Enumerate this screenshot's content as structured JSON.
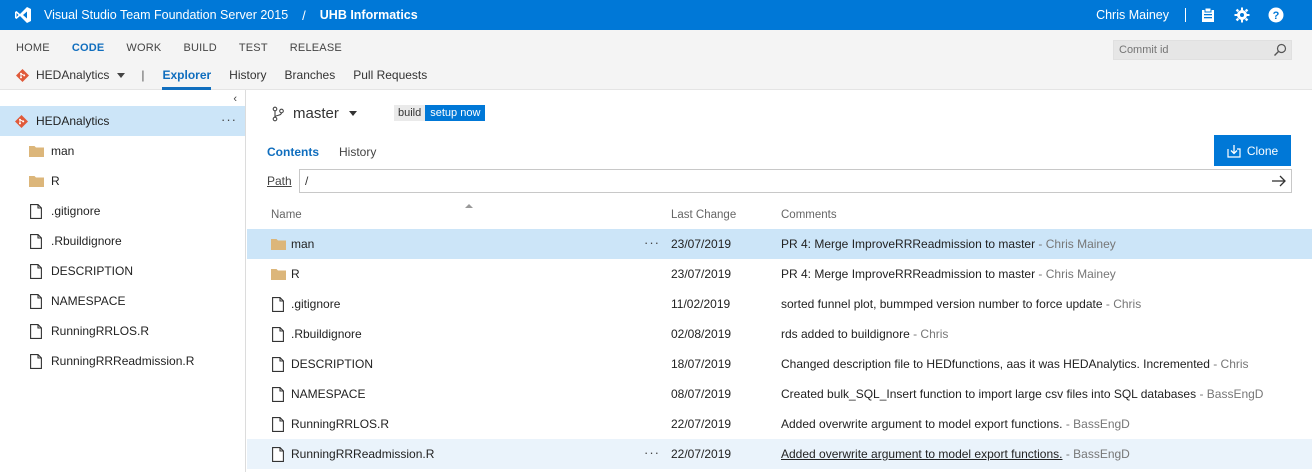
{
  "topbar": {
    "product": "Visual Studio Team Foundation Server 2015",
    "separator": "/",
    "project": "UHB Informatics",
    "user": "Chris Mainey",
    "icons": [
      "visual-studio-logo",
      "clipboard-icon",
      "gear-icon",
      "help-icon"
    ]
  },
  "hubs": [
    "HOME",
    "CODE",
    "WORK",
    "BUILD",
    "TEST",
    "RELEASE"
  ],
  "active_hub": "CODE",
  "commit_search": {
    "placeholder": "Commit id",
    "value": ""
  },
  "subnav": {
    "repo": "HEDAnalytics",
    "separator": "|",
    "tabs": [
      "Explorer",
      "History",
      "Branches",
      "Pull Requests"
    ],
    "active_tab": "Explorer"
  },
  "tree": {
    "collapse_glyph": "‹",
    "root": "HEDAnalytics",
    "more_glyph": "···",
    "items": [
      {
        "name": "man",
        "type": "folder"
      },
      {
        "name": "R",
        "type": "folder"
      },
      {
        "name": ".gitignore",
        "type": "file"
      },
      {
        "name": ".Rbuildignore",
        "type": "file"
      },
      {
        "name": "DESCRIPTION",
        "type": "file"
      },
      {
        "name": "NAMESPACE",
        "type": "file"
      },
      {
        "name": "RunningRRLOS.R",
        "type": "file"
      },
      {
        "name": "RunningRRReadmission.R",
        "type": "file"
      }
    ]
  },
  "branch": {
    "name": "master"
  },
  "build_badge": {
    "label": "build",
    "action": "setup now"
  },
  "content_tabs": [
    "Contents",
    "History"
  ],
  "active_content_tab": "Contents",
  "clone_button": "Clone",
  "path": {
    "label": "Path",
    "value": "/"
  },
  "columns": {
    "name": "Name",
    "last_change": "Last Change",
    "comments": "Comments"
  },
  "files": [
    {
      "name": "man",
      "type": "folder",
      "date": "23/07/2019",
      "message": "PR 4: Merge ImproveRRReadmission to master",
      "author": " - Chris Mainey",
      "state": "selected"
    },
    {
      "name": "R",
      "type": "folder",
      "date": "23/07/2019",
      "message": "PR 4: Merge ImproveRRReadmission to master",
      "author": " - Chris Mainey",
      "state": ""
    },
    {
      "name": ".gitignore",
      "type": "file",
      "date": "11/02/2019",
      "message": "sorted funnel plot, bummped version number to force update",
      "author": " - Chris",
      "state": ""
    },
    {
      "name": ".Rbuildignore",
      "type": "file",
      "date": "02/08/2019",
      "message": "rds added to buildignore",
      "author": " - Chris",
      "state": ""
    },
    {
      "name": "DESCRIPTION",
      "type": "file",
      "date": "18/07/2019",
      "message": "Changed description file to HEDfunctions, aas it was HEDAnalytics. Incremented",
      "author": " - Chris",
      "state": ""
    },
    {
      "name": "NAMESPACE",
      "type": "file",
      "date": "08/07/2019",
      "message": "Created bulk_SQL_Insert function to import large csv files into SQL databases",
      "author": " - BassEngD",
      "state": ""
    },
    {
      "name": "RunningRRLOS.R",
      "type": "file",
      "date": "22/07/2019",
      "message": "Added overwrite argument to model export functions.",
      "author": " - BassEngD",
      "state": ""
    },
    {
      "name": "RunningRRReadmission.R",
      "type": "file",
      "date": "22/07/2019",
      "message": "Added overwrite argument to model export functions.",
      "author": " - BassEngD",
      "state": "hover"
    }
  ],
  "row_more_glyph": "···",
  "colors": {
    "accent": "#0078d7",
    "selected_row": "#cce5f8",
    "hover_row": "#eaf3fb",
    "folder": "#dcb67a",
    "git": "#e05a3a"
  }
}
